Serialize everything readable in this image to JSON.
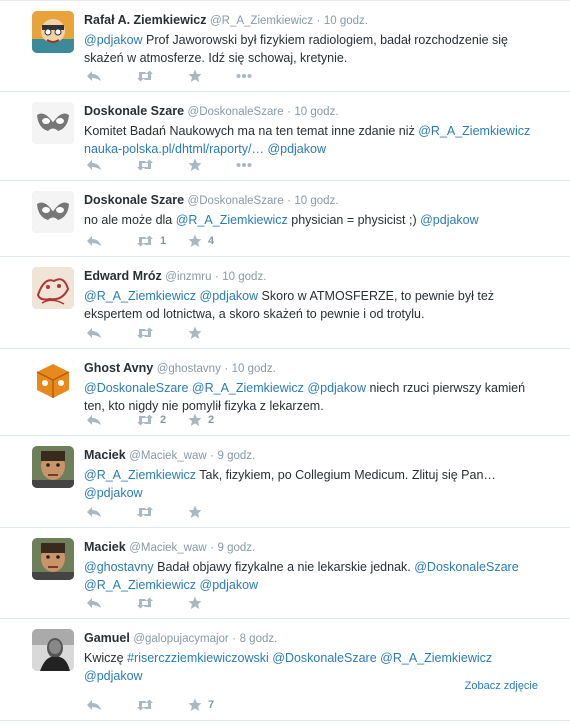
{
  "tweets": [
    {
      "fullname": "Rafał A. Ziemkiewicz",
      "username": "@R_A_Ziemkiewicz",
      "time": "10 godz.",
      "l1": [
        [
          "m",
          "@pdjakow"
        ],
        [
          "t",
          " Prof Jaworowski był fizykiem radiologiem, badał rozchodzenie się"
        ]
      ],
      "l2": [
        [
          "t",
          "skażeń w atmosferze. Idź się schowaj, kretynie."
        ]
      ],
      "retweets": "",
      "favorites": "",
      "show_more": true
    },
    {
      "fullname": "Doskonale Szare",
      "username": "@DoskonaleSzare",
      "time": "10 godz.",
      "l1": [
        [
          "t",
          "Komitet Badań Naukowych ma na ten temat inne zdanie niż "
        ],
        [
          "m",
          "@R_A_Ziemkiewicz"
        ]
      ],
      "l2": [
        [
          "l",
          "nauka-polska.pl/dhtml/raporty/…"
        ],
        [
          "t",
          " "
        ],
        [
          "m",
          "@pdjakow"
        ]
      ],
      "retweets": "",
      "favorites": "",
      "show_more": true
    },
    {
      "fullname": "Doskonale Szare",
      "username": "@DoskonaleSzare",
      "time": "10 godz.",
      "l1": [
        [
          "t",
          "no ale może dla "
        ],
        [
          "m",
          "@R_A_Ziemkiewicz"
        ],
        [
          "t",
          " physician = physicist ;) "
        ],
        [
          "m",
          "@pdjakow"
        ]
      ],
      "l2": [],
      "retweets": "1",
      "favorites": "4",
      "show_more": false
    },
    {
      "fullname": "Edward Mróz",
      "username": "@inzmru",
      "time": "10 godz.",
      "l1": [
        [
          "m",
          "@R_A_Ziemkiewicz"
        ],
        [
          "t",
          " "
        ],
        [
          "m",
          "@pdjakow"
        ],
        [
          "t",
          " Skoro w ATMOSFERZE, to pewnie był też"
        ]
      ],
      "l2": [
        [
          "t",
          "ekspertem od lotnictwa, a skoro skażeń to pewnie i od trotylu."
        ]
      ],
      "retweets": "",
      "favorites": "",
      "show_more": false
    },
    {
      "fullname": "Ghost Avny",
      "username": "@ghostavny",
      "time": "10 godz.",
      "l1": [
        [
          "m",
          "@DoskonaleSzare"
        ],
        [
          "t",
          " "
        ],
        [
          "m",
          "@R_A_Ziemkiewicz"
        ],
        [
          "t",
          " "
        ],
        [
          "m",
          "@pdjakow"
        ],
        [
          "t",
          " niech rzuci pierwszy kamień"
        ]
      ],
      "l2": [
        [
          "t",
          "ten, kto nigdy nie pomylił fizyka z lekarzem."
        ]
      ],
      "retweets": "2",
      "favorites": "2",
      "show_more": false
    },
    {
      "fullname": "Maciek",
      "username": "@Maciek_waw",
      "time": "9 godz.",
      "l1": [
        [
          "m",
          "@R_A_Ziemkiewicz"
        ],
        [
          "t",
          " Tak, fizykiem, po Collegium Medicum. Zlituj się Pan…"
        ]
      ],
      "l2": [
        [
          "m",
          "@pdjakow"
        ]
      ],
      "retweets": "",
      "favorites": "",
      "show_more": false
    },
    {
      "fullname": "Maciek",
      "username": "@Maciek_waw",
      "time": "9 godz.",
      "l1": [
        [
          "m",
          "@ghostavny"
        ],
        [
          "t",
          " Badał objawy fizykalne a nie lekarskie jednak. "
        ],
        [
          "m",
          "@DoskonaleSzare"
        ]
      ],
      "l2": [
        [
          "m",
          "@R_A_Ziemkiewicz"
        ],
        [
          "t",
          " "
        ],
        [
          "m",
          "@pdjakow"
        ]
      ],
      "retweets": "",
      "favorites": "",
      "show_more": false
    },
    {
      "fullname": "Gamuel",
      "username": "@galopujacymajor",
      "time": "8 godz.",
      "l1": [
        [
          "t",
          "Kwiczę "
        ],
        [
          "m",
          "#riserczziemkiewiczowski"
        ],
        [
          "t",
          "  "
        ],
        [
          "m",
          "@DoskonaleSzare"
        ],
        [
          "t",
          " "
        ],
        [
          "m",
          "@R_A_Ziemkiewicz"
        ]
      ],
      "l2": [
        [
          "m",
          "@pdjakow"
        ]
      ],
      "retweets": "",
      "favorites": "7",
      "show_more": false,
      "photo_link": "Zobacz zdjęcie"
    }
  ],
  "separator": "·",
  "colors": {
    "link": "#2b7bb9",
    "muted": "#8899a6",
    "text": "#292f33",
    "divider": "#e1e8ed"
  },
  "icons": {
    "reply": "reply-icon",
    "retweet": "retweet-icon",
    "favorite": "star-icon",
    "more": "more-dots-icon"
  }
}
